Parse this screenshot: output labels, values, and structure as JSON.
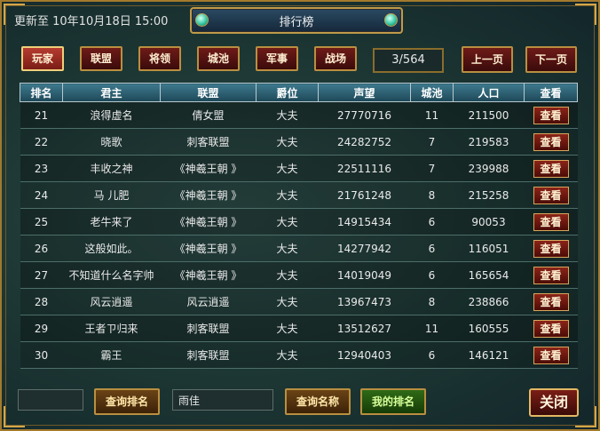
{
  "updated_text": "更新至 10年10月18日 15:00",
  "window_title": "排行榜",
  "tabs": [
    {
      "label": "玩家",
      "active": true
    },
    {
      "label": "联盟",
      "active": false
    },
    {
      "label": "将领",
      "active": false
    },
    {
      "label": "城池",
      "active": false
    },
    {
      "label": "军事",
      "active": false
    },
    {
      "label": "战场",
      "active": false
    }
  ],
  "pagination": {
    "indicator": "3/564",
    "prev_label": "上一页",
    "next_label": "下一页"
  },
  "table": {
    "headers": [
      "排名",
      "君主",
      "联盟",
      "爵位",
      "声望",
      "城池",
      "人口",
      "查看"
    ],
    "view_label": "查看",
    "rows": [
      {
        "rank": "21",
        "lord": "浪得虚名",
        "alliance": "倩女盟",
        "title": "大夫",
        "prestige": "27770716",
        "cities": "11",
        "population": "211500"
      },
      {
        "rank": "22",
        "lord": "晓歌",
        "alliance": "刺客联盟",
        "title": "大夫",
        "prestige": "24282752",
        "cities": "7",
        "population": "219583"
      },
      {
        "rank": "23",
        "lord": "丰收之神",
        "alliance": "《神羲王朝 》",
        "title": "大夫",
        "prestige": "22511116",
        "cities": "7",
        "population": "239988"
      },
      {
        "rank": "24",
        "lord": "马 儿肥",
        "alliance": "《神羲王朝 》",
        "title": "大夫",
        "prestige": "21761248",
        "cities": "8",
        "population": "215258"
      },
      {
        "rank": "25",
        "lord": "老牛来了",
        "alliance": "《神羲王朝 》",
        "title": "大夫",
        "prestige": "14915434",
        "cities": "6",
        "population": "90053"
      },
      {
        "rank": "26",
        "lord": "这般如此。",
        "alliance": "《神羲王朝 》",
        "title": "大夫",
        "prestige": "14277942",
        "cities": "6",
        "population": "116051"
      },
      {
        "rank": "27",
        "lord": "不知道什么名字帅",
        "alliance": "《神羲王朝 》",
        "title": "大夫",
        "prestige": "14019049",
        "cities": "6",
        "population": "165654"
      },
      {
        "rank": "28",
        "lord": "风云逍遥",
        "alliance": "风云逍遥",
        "title": "大夫",
        "prestige": "13967473",
        "cities": "8",
        "population": "238866"
      },
      {
        "rank": "29",
        "lord": "王者ㄗ归来",
        "alliance": "刺客联盟",
        "title": "大夫",
        "prestige": "13512627",
        "cities": "11",
        "population": "160555"
      },
      {
        "rank": "30",
        "lord": "霸王",
        "alliance": "刺客联盟",
        "title": "大夫",
        "prestige": "12940403",
        "cities": "6",
        "population": "146121"
      }
    ]
  },
  "bottom": {
    "rank_input_value": "",
    "query_rank_label": "查询排名",
    "name_input_value": "雨佳",
    "query_name_label": "查询名称",
    "my_rank_label": "我的排名",
    "close_label": "关闭"
  },
  "colors": {
    "accent_gold": "#b98f40",
    "button_red": "#6e1b18",
    "my_rank_green": "#2f6a16"
  }
}
